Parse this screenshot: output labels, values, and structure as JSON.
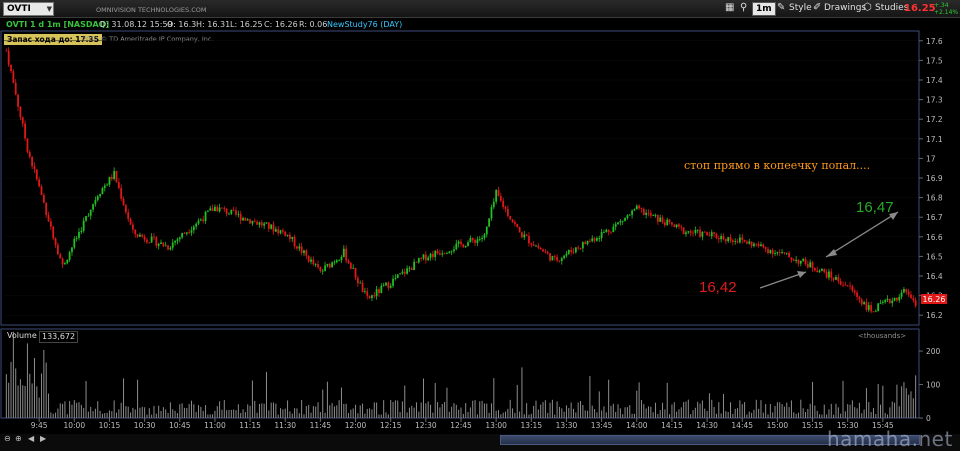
{
  "toolbar": {
    "symbol": "OVTI",
    "aggregation": "1m",
    "style_label": "Style",
    "drawings_label": "Drawings",
    "studies_label": "Studies",
    "last_price": "16.25",
    "change_abs": "+.34",
    "change_pct": "+2.14%"
  },
  "infobar": {
    "title": "OVTI 1 d 1m [NASDAQ]",
    "date": "D: 31.08.12 15:59",
    "open": "O: 16.3",
    "high": "H: 16.31",
    "low": "L: 16.25",
    "close": "C: 16.26",
    "range": "R: 0.06",
    "study": "NewStudy76 (DAY)"
  },
  "company_name": "OMNIVISION TECHNOLOGIES.COM",
  "reserve_label": "Запас хода до: 17.35",
  "copyright": "2012 © TD Ameritrade IP Company, Inc.",
  "annotations": {
    "comment": "стоп прямо в копеечку попал....",
    "entry_price": "16,42",
    "exit_price": "16,47"
  },
  "price_axis": {
    "ticks": [
      "17.6",
      "17.5",
      "17.4",
      "17.3",
      "17.2",
      "17.1",
      "17",
      "16.9",
      "16.8",
      "16.7",
      "16.6",
      "16.5",
      "16.4",
      "16.3",
      "16.2"
    ],
    "current_label": "16.26"
  },
  "volume_panel": {
    "label": "Volume",
    "value": "133,672",
    "units_label": "<thousands>",
    "ticks": [
      "200",
      "100",
      "0"
    ]
  },
  "time_axis": {
    "ticks": [
      "9:45",
      "10:00",
      "10:15",
      "10:30",
      "10:45",
      "11:00",
      "11:15",
      "11:30",
      "11:45",
      "12:00",
      "12:15",
      "12:30",
      "12:45",
      "13:00",
      "13:15",
      "13:30",
      "13:45",
      "14:00",
      "14:15",
      "14:30",
      "14:45",
      "15:00",
      "15:15",
      "15:30",
      "15:45"
    ]
  },
  "watermark": "hamaha.net",
  "colors": {
    "up": "#22c022",
    "down": "#e01818",
    "panel_border": "#3c4a7a",
    "annotation_orange": "#ff9a1a",
    "entry_red": "#e01c1c",
    "exit_green": "#2aa82a"
  },
  "chart_data": {
    "type": "candlestick",
    "x_unit": "time (1-minute bars)",
    "x_range": [
      "9:30",
      "16:00"
    ],
    "y_range": [
      16.15,
      17.65
    ],
    "volume_range_thousands": [
      0,
      260
    ],
    "key_prices": [
      {
        "time": "9:31",
        "price": 17.55
      },
      {
        "time": "9:40",
        "price": 17.05
      },
      {
        "time": "9:55",
        "price": 16.45
      },
      {
        "time": "10:10",
        "price": 16.82
      },
      {
        "time": "10:17",
        "price": 16.92
      },
      {
        "time": "10:25",
        "price": 16.62
      },
      {
        "time": "10:40",
        "price": 16.55
      },
      {
        "time": "11:00",
        "price": 16.75
      },
      {
        "time": "11:30",
        "price": 16.62
      },
      {
        "time": "11:45",
        "price": 16.42
      },
      {
        "time": "11:55",
        "price": 16.52
      },
      {
        "time": "12:05",
        "price": 16.28
      },
      {
        "time": "12:30",
        "price": 16.5
      },
      {
        "time": "12:55",
        "price": 16.6
      },
      {
        "time": "13:00",
        "price": 16.82
      },
      {
        "time": "13:10",
        "price": 16.62
      },
      {
        "time": "13:25",
        "price": 16.48
      },
      {
        "time": "13:50",
        "price": 16.65
      },
      {
        "time": "14:00",
        "price": 16.74
      },
      {
        "time": "14:20",
        "price": 16.63
      },
      {
        "time": "14:45",
        "price": 16.58
      },
      {
        "time": "15:00",
        "price": 16.52
      },
      {
        "time": "15:15",
        "price": 16.45
      },
      {
        "time": "15:30",
        "price": 16.35
      },
      {
        "time": "15:40",
        "price": 16.22
      },
      {
        "time": "15:55",
        "price": 16.32
      },
      {
        "time": "15:59",
        "price": 16.26
      }
    ]
  }
}
